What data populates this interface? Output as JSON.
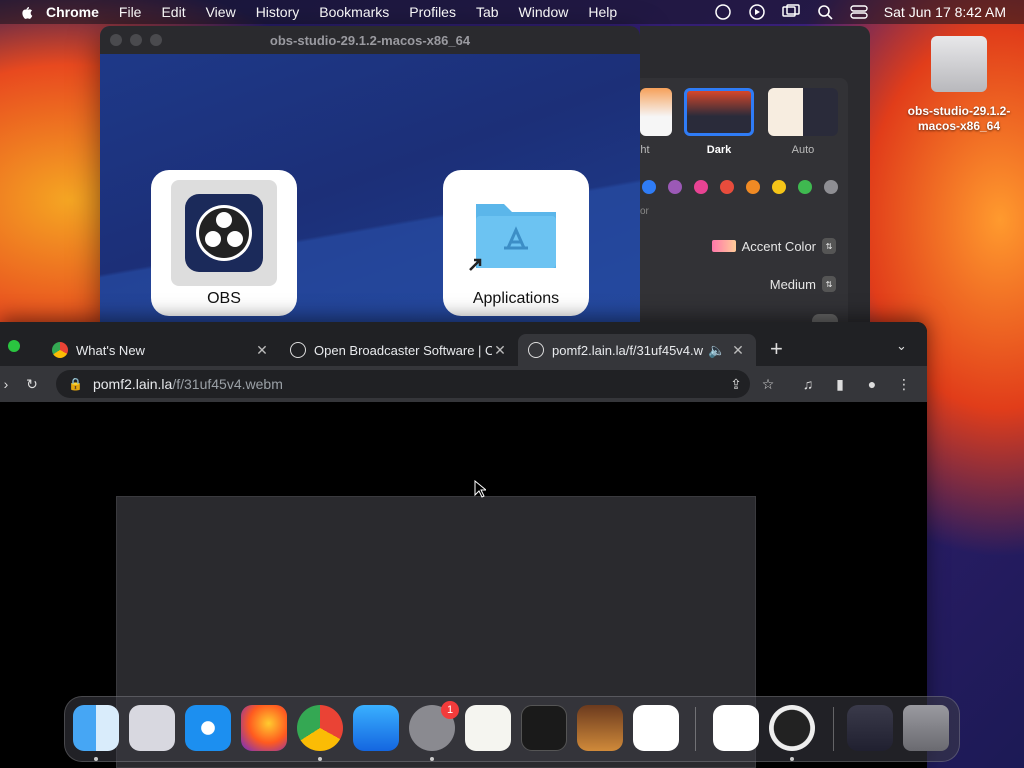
{
  "menubar": {
    "app": "Chrome",
    "items": [
      "File",
      "Edit",
      "View",
      "History",
      "Bookmarks",
      "Profiles",
      "Tab",
      "Window",
      "Help"
    ],
    "clock": "Sat Jun 17  8:42 AM"
  },
  "dmg_window": {
    "title": "obs-studio-29.1.2-macos-x86_64",
    "icons": [
      {
        "label": "OBS"
      },
      {
        "label": "Applications"
      }
    ]
  },
  "settings": {
    "themes": [
      {
        "label": "ht"
      },
      {
        "label": "Dark"
      },
      {
        "label": "Auto"
      }
    ],
    "accent_label": "Accent Color",
    "size_label": "Medium",
    "partial_label": "or"
  },
  "desktop": {
    "drive_label": "obs-studio-29.1.2-macos-x86_64"
  },
  "chrome": {
    "tabs": [
      {
        "title": "What's New"
      },
      {
        "title": "Open Broadcaster Software | O"
      },
      {
        "title": "pomf2.lain.la/f/31uf45v4.w"
      }
    ],
    "url_host": "pomf2.lain.la",
    "url_path": "/f/31uf45v4.webm",
    "video_placeholder": ""
  },
  "dock": {
    "finder_icon": "finder-icon",
    "settings_badge": "1"
  }
}
